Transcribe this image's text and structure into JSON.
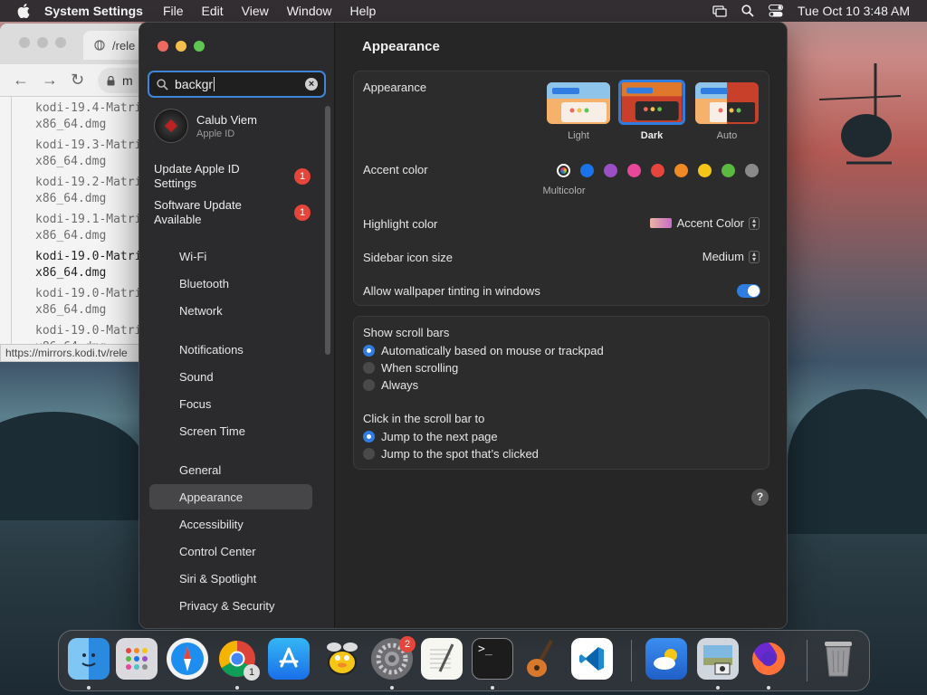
{
  "menubar": {
    "app_name": "System Settings",
    "menus": [
      "File",
      "Edit",
      "View",
      "Window",
      "Help"
    ],
    "clock": "Tue Oct 10  3:48 AM"
  },
  "browser": {
    "tab_title": "/rele",
    "url": "m",
    "files": [
      {
        "line1": "kodi-19.4-Matrix",
        "line2": "x86_64.dmg"
      },
      {
        "line1": "kodi-19.3-Matrix",
        "line2": "x86_64.dmg"
      },
      {
        "line1": "kodi-19.2-Matrix",
        "line2": "x86_64.dmg"
      },
      {
        "line1": "kodi-19.1-Matrix",
        "line2": "x86_64.dmg"
      },
      {
        "line1": "kodi-19.0-Matrix",
        "line2": "x86_64.dmg"
      },
      {
        "line1": "kodi-19.0-Matrix",
        "line2": "x86_64.dmg"
      },
      {
        "line1": "kodi-19.0-Matrix",
        "line2": "x86_64.dmg"
      }
    ],
    "status_url": "https://mirrors.kodi.tv/rele"
  },
  "settings": {
    "search_value": "backgr",
    "profile": {
      "name": "Calub Viem",
      "subtitle": "Apple ID"
    },
    "alerts": [
      {
        "label": "Update Apple ID Settings",
        "badge": "1"
      },
      {
        "label": "Software Update Available",
        "badge": "1"
      }
    ],
    "sidebar_items": [
      "Wi-Fi",
      "Bluetooth",
      "Network",
      "Notifications",
      "Sound",
      "Focus",
      "Screen Time",
      "General",
      "Appearance",
      "Accessibility",
      "Control Center",
      "Siri & Spotlight",
      "Privacy & Security"
    ],
    "selected_item": "Appearance",
    "main": {
      "title": "Appearance",
      "appearance_label": "Appearance",
      "appearance_options": [
        "Light",
        "Dark",
        "Auto"
      ],
      "appearance_selected": "Dark",
      "accent_label": "Accent color",
      "accent_colors": [
        "multicolor",
        "#1a73e8",
        "#9b4fc4",
        "#e8479a",
        "#e5453b",
        "#f08a24",
        "#f5c518",
        "#5bb840",
        "#8a8a8a"
      ],
      "accent_selected_label": "Multicolor",
      "highlight_label": "Highlight color",
      "highlight_value": "Accent Color",
      "sidebar_size_label": "Sidebar icon size",
      "sidebar_size_value": "Medium",
      "tinting_label": "Allow wallpaper tinting in windows",
      "tinting_on": true,
      "scroll_label": "Show scroll bars",
      "scroll_options": [
        "Automatically based on mouse or trackpad",
        "When scrolling",
        "Always"
      ],
      "scroll_selected": 0,
      "click_label": "Click in the scroll bar to",
      "click_options": [
        "Jump to the next page",
        "Jump to the spot that’s clicked"
      ],
      "click_selected": 0,
      "help_label": "?"
    }
  },
  "dock": {
    "apps": [
      "finder-icon",
      "launchpad-icon",
      "safari-icon",
      "chrome-icon",
      "app-store-icon",
      "cyberduck-icon",
      "system-settings-icon",
      "textedit-icon",
      "terminal-icon",
      "garageband-icon",
      "vscode-icon",
      "weather-icon",
      "preview-icon",
      "firefox-icon",
      "trash-icon"
    ],
    "chrome_badge": "1",
    "settings_badge": "2"
  }
}
